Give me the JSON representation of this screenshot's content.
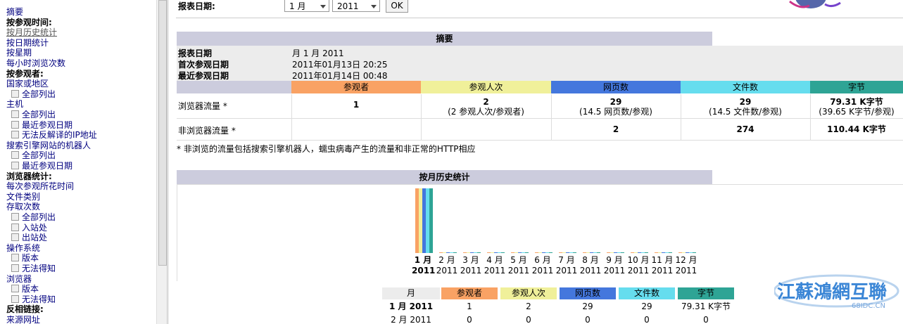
{
  "nav": {
    "items": [
      {
        "label": "摘要",
        "type": "link"
      },
      {
        "label": "按参观时间:",
        "type": "bold"
      },
      {
        "label": "按月历史统计",
        "type": "visited"
      },
      {
        "label": "按日期统计",
        "type": "link"
      },
      {
        "label": "按星期",
        "type": "link"
      },
      {
        "label": "每小时浏览次数",
        "type": "link"
      },
      {
        "label": "按参观者:",
        "type": "bold"
      },
      {
        "label": "国家或地区",
        "type": "link"
      },
      {
        "label": "全部列出",
        "type": "sub"
      },
      {
        "label": "主机",
        "type": "link"
      },
      {
        "label": "全部列出",
        "type": "sub"
      },
      {
        "label": "最近参观日期",
        "type": "sub"
      },
      {
        "label": "无法反解译的IP地址",
        "type": "sub"
      },
      {
        "label": "搜索引擎网站的机器人",
        "type": "link"
      },
      {
        "label": "全部列出",
        "type": "sub"
      },
      {
        "label": "最近参观日期",
        "type": "sub"
      },
      {
        "label": "浏览器统计:",
        "type": "bold"
      },
      {
        "label": "每次参观所花时间",
        "type": "link"
      },
      {
        "label": "文件类别",
        "type": "link"
      },
      {
        "label": "存取次数",
        "type": "link"
      },
      {
        "label": "全部列出",
        "type": "sub"
      },
      {
        "label": "入站处",
        "type": "sub"
      },
      {
        "label": "出站处",
        "type": "sub"
      },
      {
        "label": "操作系统",
        "type": "link"
      },
      {
        "label": "版本",
        "type": "sub"
      },
      {
        "label": "无法得知",
        "type": "sub"
      },
      {
        "label": "浏览器",
        "type": "link"
      },
      {
        "label": "版本",
        "type": "sub"
      },
      {
        "label": "无法得知",
        "type": "sub"
      },
      {
        "label": "反相链接:",
        "type": "bold"
      },
      {
        "label": "来源网址",
        "type": "link"
      }
    ]
  },
  "header": {
    "report_date_label": "报表日期:",
    "month_select": "1 月",
    "year_select": "2011",
    "ok_button": "OK"
  },
  "summary": {
    "title": "摘要",
    "report_date_label": "报表日期",
    "report_date_value": "月 1 月 2011",
    "first_visit_label": "首次参观日期",
    "first_visit_value": "2011年01月13日 20:25",
    "last_visit_label": "最近参观日期",
    "last_visit_value": "2011年01月14日 00:48",
    "columns": [
      "参观者",
      "参观人次",
      "网页数",
      "文件数",
      "字节"
    ],
    "column_colors": [
      "#f9a264",
      "#f0f09a",
      "#4477dd",
      "#66ddee",
      "#2ea495"
    ],
    "rows": [
      {
        "label": "浏览器流量 *",
        "cells": [
          {
            "main": "1",
            "sub": ""
          },
          {
            "main": "2",
            "sub": "(2 参观人次/参观者)"
          },
          {
            "main": "29",
            "sub": "(14.5 网页数/参观)"
          },
          {
            "main": "29",
            "sub": "(14.5 文件数/参观)"
          },
          {
            "main": "79.31 K字节",
            "sub": "(39.65 K字节/参观)"
          }
        ]
      },
      {
        "label": "非浏览器流量 *",
        "cells": [
          {
            "main": "",
            "sub": ""
          },
          {
            "main": "",
            "sub": ""
          },
          {
            "main": "2",
            "sub": ""
          },
          {
            "main": "274",
            "sub": ""
          },
          {
            "main": "110.44 K字节",
            "sub": ""
          }
        ]
      }
    ],
    "footnote": "* 非浏览的流量包括搜索引擎机器人，蠕虫病毒产生的流量和非正常的HTTP相应"
  },
  "monthly": {
    "title": "按月历史统计",
    "months": [
      "1 月",
      "2 月",
      "3 月",
      "4 月",
      "5 月",
      "6 月",
      "7 月",
      "8 月",
      "9 月",
      "10 月",
      "11 月",
      "12 月"
    ],
    "year": "2011",
    "current_month_index": 0
  },
  "chart_data": {
    "type": "bar",
    "categories": [
      "1 月 2011",
      "2 月 2011",
      "3 月 2011",
      "4 月 2011",
      "5 月 2011",
      "6 月 2011",
      "7 月 2011",
      "8 月 2011",
      "9 月 2011",
      "10 月 2011",
      "11 月 2011",
      "12 月 2011"
    ],
    "series": [
      {
        "name": "参观者",
        "color": "#f9a264",
        "values": [
          1,
          0,
          0,
          0,
          0,
          0,
          0,
          0,
          0,
          0,
          0,
          0
        ]
      },
      {
        "name": "参观人次",
        "color": "#f0f09a",
        "values": [
          2,
          0,
          0,
          0,
          0,
          0,
          0,
          0,
          0,
          0,
          0,
          0
        ]
      },
      {
        "name": "网页数",
        "color": "#4477dd",
        "values": [
          29,
          0,
          0,
          0,
          0,
          0,
          0,
          0,
          0,
          0,
          0,
          0
        ]
      },
      {
        "name": "文件数",
        "color": "#66ddee",
        "values": [
          29,
          0,
          0,
          0,
          0,
          0,
          0,
          0,
          0,
          0,
          0,
          0
        ]
      },
      {
        "name": "字节",
        "color": "#2ea495",
        "values": [
          79.31,
          0,
          0,
          0,
          0,
          0,
          0,
          0,
          0,
          0,
          0,
          0
        ]
      }
    ]
  },
  "monthly_table": {
    "columns": [
      "月",
      "参观者",
      "参观人次",
      "网页数",
      "文件数",
      "字节"
    ],
    "rows": [
      [
        "1 月 2011",
        "1",
        "2",
        "29",
        "29",
        "79.31 K字节"
      ],
      [
        "2 月 2011",
        "0",
        "0",
        "0",
        "0",
        "0"
      ]
    ]
  },
  "watermark": {
    "main": "江蘇鴻網互聯",
    "sub": "68IDC.CN"
  }
}
